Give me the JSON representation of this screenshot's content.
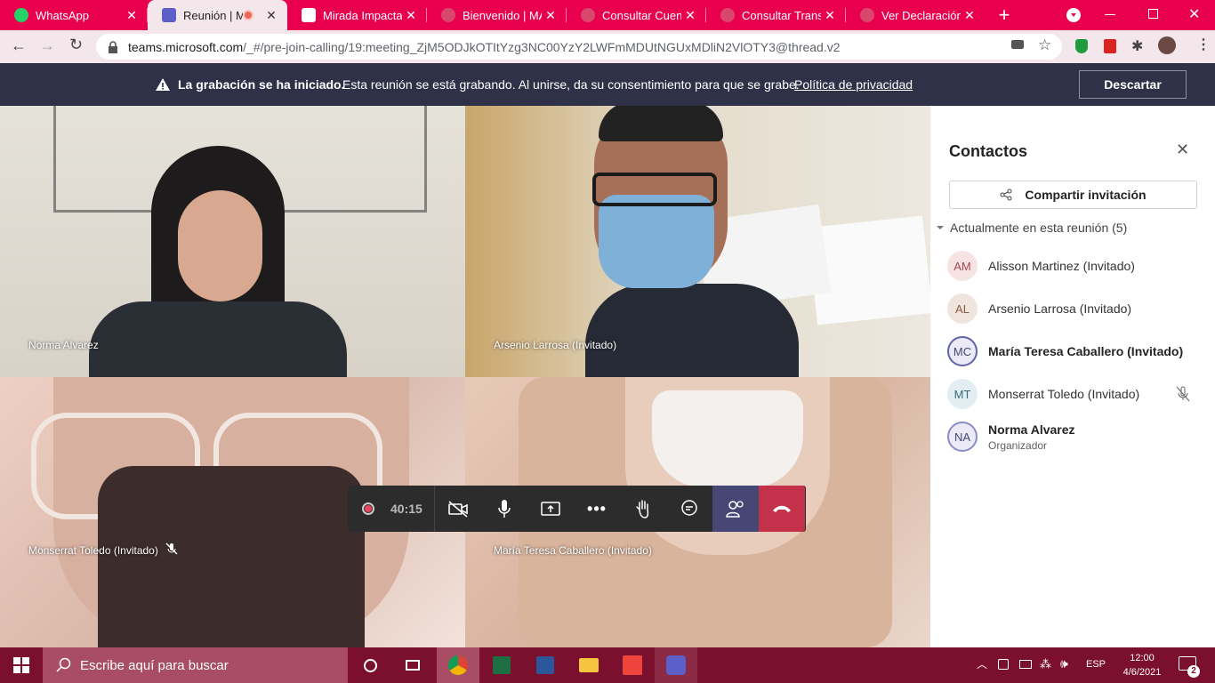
{
  "tabs": [
    {
      "label": "WhatsApp",
      "color": "#25d366"
    },
    {
      "label": "Reunión | Mic",
      "color": "#5b5fc7"
    },
    {
      "label": "Mirada Impactant",
      "color": "#ffffff"
    },
    {
      "label": "Bienvenido | MAR",
      "color": "#d9486c"
    },
    {
      "label": "Consultar Cuenta",
      "color": "#d9486c"
    },
    {
      "label": "Consultar Transac",
      "color": "#d9486c"
    },
    {
      "label": "Ver Declaración |",
      "color": "#d9486c"
    }
  ],
  "url": {
    "host": "teams.microsoft.com",
    "path": "/_#/pre-join-calling/19:meeting_ZjM5ODJkOTItYzg3NC00YzY2LWFmMDUtNGUxMDliN2VlOTY3@thread.v2"
  },
  "banner": {
    "bold": "La grabación se ha iniciado.",
    "text": "Esta reunión se está grabando. Al unirse, da su consentimiento para que se grabe.",
    "link": "Política de privacidad",
    "dismiss": "Descartar"
  },
  "videos": [
    {
      "name": "Norma Alvarez"
    },
    {
      "name": "Arsenio Larrosa (Invitado)"
    },
    {
      "name": "Monserrat Toledo (Invitado)"
    },
    {
      "name": "María Teresa Caballero (Invitado)"
    }
  ],
  "controls": {
    "timer": "40:15"
  },
  "panel": {
    "title": "Contactos",
    "share": "Compartir invitación",
    "section": "Actualmente en esta reunión (5)",
    "people": [
      {
        "initials": "AM",
        "name": "Alisson Martinez (Invitado)",
        "sub": ""
      },
      {
        "initials": "AL",
        "name": "Arsenio Larrosa (Invitado)",
        "sub": ""
      },
      {
        "initials": "MC",
        "name": "María Teresa Caballero (Invitado)",
        "sub": ""
      },
      {
        "initials": "MT",
        "name": "Monserrat Toledo (Invitado)",
        "sub": ""
      },
      {
        "initials": "NA",
        "name": "Norma Alvarez",
        "sub": "Organizador"
      }
    ]
  },
  "taskbar": {
    "search": "Escribe aquí para buscar",
    "lang": "ESP",
    "time": "12:00",
    "date": "4/6/2021",
    "notif": "2"
  }
}
